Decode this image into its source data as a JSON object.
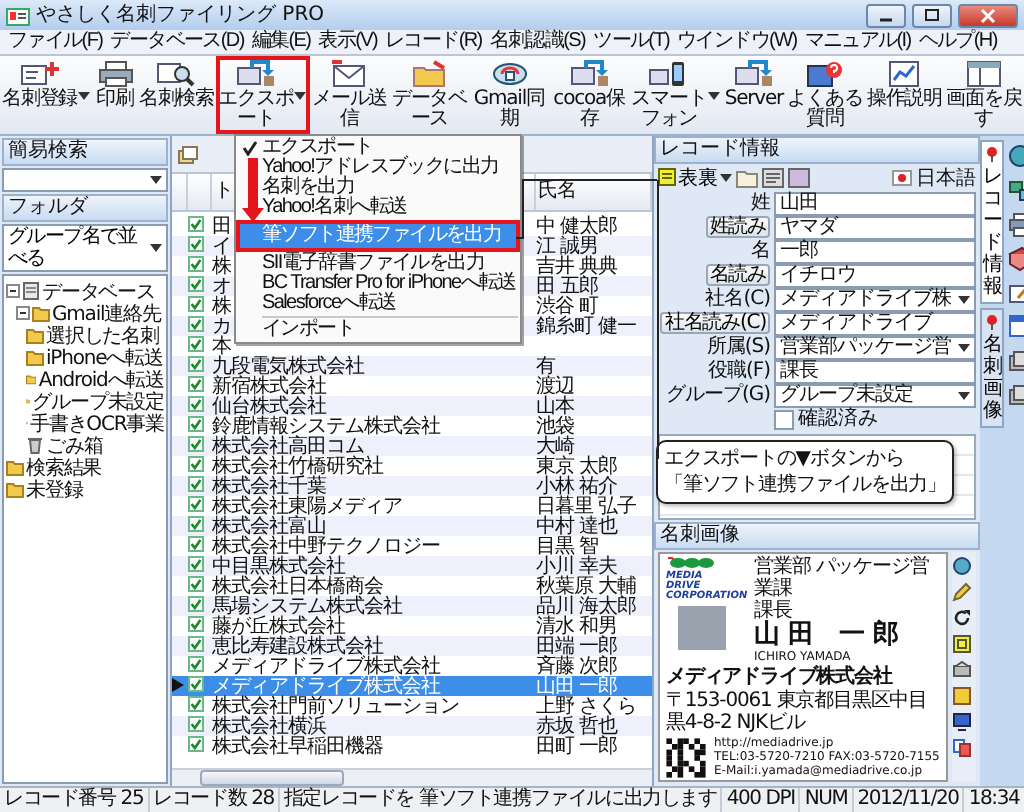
{
  "window": {
    "title": "やさしく名刺ファイリング PRO"
  },
  "menu_bar": [
    "ファイル(F)",
    "データベース(D)",
    "編集(E)",
    "表示(V)",
    "レコード(R)",
    "名刺認識(S)",
    "ツール(T)",
    "ウインドウ(W)",
    "マニュアル(I)",
    "ヘルプ(H)"
  ],
  "toolbar": [
    {
      "label": "名刺登録",
      "kind": "split",
      "highlighted": false
    },
    {
      "label": "印刷",
      "kind": "button",
      "highlighted": false
    },
    {
      "label": "名刺検索",
      "kind": "button",
      "highlighted": false
    },
    {
      "label": "エクスポート",
      "kind": "split",
      "highlighted": true
    },
    {
      "label": "メール送信",
      "kind": "button",
      "highlighted": false
    },
    {
      "label": "データベース",
      "kind": "button",
      "highlighted": false
    },
    {
      "label": "Gmail同期",
      "kind": "button",
      "highlighted": false
    },
    {
      "label": "cocoa保存",
      "kind": "button",
      "highlighted": false
    },
    {
      "label": "スマートフォン",
      "kind": "split",
      "highlighted": false
    },
    {
      "label": "Server",
      "kind": "button",
      "highlighted": false
    },
    {
      "label": "よくある質問",
      "kind": "button",
      "highlighted": false
    },
    {
      "label": "操作説明",
      "kind": "button",
      "highlighted": false
    },
    {
      "label": "画面を戻す",
      "kind": "button",
      "highlighted": false
    }
  ],
  "export_menu": {
    "items": [
      {
        "kind": "item",
        "label": "エクスポート",
        "checked": true,
        "selected": false,
        "highlighted": false
      },
      {
        "kind": "item",
        "label": "Yahoo!アドレスブックに出力",
        "checked": false,
        "selected": false,
        "highlighted": false
      },
      {
        "kind": "item",
        "label": "名刺を出力",
        "checked": false,
        "selected": false,
        "highlighted": false
      },
      {
        "kind": "item",
        "label": "Yahoo!名刺へ転送",
        "checked": false,
        "selected": false,
        "highlighted": false
      },
      {
        "kind": "item",
        "label": "筆ソフト連携ファイルを出力",
        "checked": false,
        "selected": true,
        "highlighted": true
      },
      {
        "kind": "item",
        "label": "SII電子辞書ファイルを出力",
        "checked": false,
        "selected": false,
        "highlighted": false
      },
      {
        "kind": "item",
        "label": "BC Transfer Pro for iPhoneへ転送",
        "checked": false,
        "selected": false,
        "highlighted": false
      },
      {
        "kind": "item",
        "label": "Salesforceへ転送",
        "checked": false,
        "selected": false,
        "highlighted": false
      },
      {
        "kind": "separator"
      },
      {
        "kind": "item",
        "label": "インポート",
        "checked": false,
        "selected": false,
        "highlighted": false
      }
    ]
  },
  "callout": {
    "lines": [
      "エクスポートの▼ボタンから",
      "「筆ソフト連携ファイルを出力」"
    ]
  },
  "quick_search": {
    "title": "簡易検索"
  },
  "folder": {
    "title": "フォルダ",
    "sort": "グループ名で並べる",
    "tree": [
      {
        "label": "データベース",
        "kind": "database",
        "expanded": true,
        "children": [
          {
            "label": "Gmail連絡先",
            "kind": "folder",
            "expanded": true,
            "children": [
              {
                "label": "選択した名刺",
                "kind": "folder"
              },
              {
                "label": "iPhoneへ転送",
                "kind": "folder"
              },
              {
                "label": "Androidへ転送",
                "kind": "folder"
              },
              {
                "label": "グループ未設定",
                "kind": "folder"
              },
              {
                "label": "手書きOCR事業",
                "kind": "folder"
              },
              {
                "label": "ごみ箱",
                "kind": "trash"
              }
            ]
          }
        ]
      },
      {
        "label": "検索結果",
        "kind": "folder"
      },
      {
        "label": "未登録",
        "kind": "folder"
      }
    ]
  },
  "card_list": {
    "columns": [
      "ト",
      "氏名"
    ],
    "rows": [
      {
        "checked": true,
        "selected": false,
        "company": "田",
        "name": "中 健太郎"
      },
      {
        "checked": true,
        "selected": false,
        "company": "イ",
        "name": "江 誠男"
      },
      {
        "checked": true,
        "selected": false,
        "company": "株",
        "name": "吉井 典典"
      },
      {
        "checked": true,
        "selected": false,
        "company": "オ",
        "name": "田 五郎"
      },
      {
        "checked": true,
        "selected": false,
        "company": "株",
        "name": "渋谷 町"
      },
      {
        "checked": true,
        "selected": false,
        "company": "カ",
        "name": "錦糸町 健一"
      },
      {
        "checked": true,
        "selected": false,
        "company": "本"
      },
      {
        "checked": true,
        "selected": false,
        "company": "九段電気株式会社",
        "name": "有"
      },
      {
        "checked": true,
        "selected": false,
        "company": "新宿株式会社",
        "name": "渡辺"
      },
      {
        "checked": true,
        "selected": false,
        "company": "仙台株式会社",
        "name": "山本"
      },
      {
        "checked": true,
        "selected": false,
        "company": "鈴鹿情報システム株式会社",
        "name": "池袋"
      },
      {
        "checked": true,
        "selected": false,
        "company": "株式会社高田コム",
        "name": "大崎"
      },
      {
        "checked": true,
        "selected": false,
        "company": "株式会社竹橋研究社",
        "name": "東京 太郎"
      },
      {
        "checked": true,
        "selected": false,
        "company": "株式会社千葉",
        "name": "小林 祐介"
      },
      {
        "checked": true,
        "selected": false,
        "company": "株式会社東陽メディア",
        "name": "日暮里 弘子"
      },
      {
        "checked": true,
        "selected": false,
        "company": "株式会社富山",
        "name": "中村 達也"
      },
      {
        "checked": true,
        "selected": false,
        "company": "株式会社中野テクノロジー",
        "name": "目黒 智"
      },
      {
        "checked": true,
        "selected": false,
        "company": "中目黒株式会社",
        "name": "小川 幸夫"
      },
      {
        "checked": true,
        "selected": false,
        "company": "株式会社日本橋商会",
        "name": "秋葉原 大輔"
      },
      {
        "checked": true,
        "selected": false,
        "company": "馬場システム株式会社",
        "name": "品川 海太郎"
      },
      {
        "checked": true,
        "selected": false,
        "company": "藤が丘株式会社",
        "name": "清水 和男"
      },
      {
        "checked": true,
        "selected": false,
        "company": "恵比寿建設株式会社",
        "name": "田端 一郎"
      },
      {
        "checked": true,
        "selected": false,
        "company": "メディアドライブ株式会社",
        "name": "斉藤 次郎"
      },
      {
        "checked": true,
        "selected": true,
        "company": "メディアドライブ株式会社",
        "name": "山田 一郎"
      },
      {
        "checked": true,
        "selected": false,
        "company": "株式会社門前ソリューション",
        "name": "上野 さくら"
      },
      {
        "checked": true,
        "selected": false,
        "company": "株式会社横浜",
        "name": "赤坂 哲也"
      },
      {
        "checked": true,
        "selected": false,
        "company": "株式会社早稲田機器",
        "name": "田町 一郎"
      }
    ]
  },
  "record": {
    "title": "レコード情報",
    "view": "表裏",
    "language": "日本語",
    "fields": [
      {
        "kind": "text",
        "label": "姓",
        "label_button": false,
        "value": "山田"
      },
      {
        "kind": "text",
        "label": "姓読み",
        "label_button": true,
        "value": "ヤマダ"
      },
      {
        "kind": "text",
        "label": "名",
        "label_button": false,
        "value": "一郎"
      },
      {
        "kind": "text",
        "label": "名読み",
        "label_button": true,
        "value": "イチロウ"
      },
      {
        "kind": "select",
        "label": "社名(C)",
        "label_button": false,
        "value": "メディアドライブ株"
      },
      {
        "kind": "text",
        "label": "社名読み(C)",
        "label_button": true,
        "value": "メディアドライブ"
      },
      {
        "kind": "select",
        "label": "所属(S)",
        "label_button": false,
        "value": "営業部パッケージ営"
      },
      {
        "kind": "text",
        "label": "役職(F)",
        "label_button": false,
        "value": "課長"
      },
      {
        "kind": "select",
        "label": "グループ(G)",
        "label_button": false,
        "value": "グループ未設定"
      },
      {
        "kind": "checkbox",
        "label": "確認済み",
        "checked": false
      }
    ]
  },
  "side_tabs": [
    {
      "label": "レコード情報",
      "selected": true
    },
    {
      "label": "名刺画像",
      "selected": false
    }
  ],
  "card_image": {
    "title": "名刺画像",
    "logo": [
      "MEDIA",
      "DRIVE",
      "CORPORATION"
    ],
    "department": "営業部 パッケージ営業課",
    "position": "課長",
    "name": "山田 一郎",
    "name_roman": "ICHIRO YAMADA",
    "company": "メディアドライブ株式会社",
    "url": "http://mediadrive.jp",
    "address": "〒153-0061 東京都目黒区中目黒4-8-2 NJKビル",
    "phone": "TEL:03-5720-7210 FAX:03-5720-7155",
    "email": "E-Mail:i.yamada@mediadrive.co.jp"
  },
  "status_bar": [
    "レコード番号 25",
    "レコード数 28",
    "指定レコードを 筆ソフト連携ファイルに出力します",
    "400 DPI",
    "NUM",
    "2012/11/20",
    "18:34"
  ]
}
